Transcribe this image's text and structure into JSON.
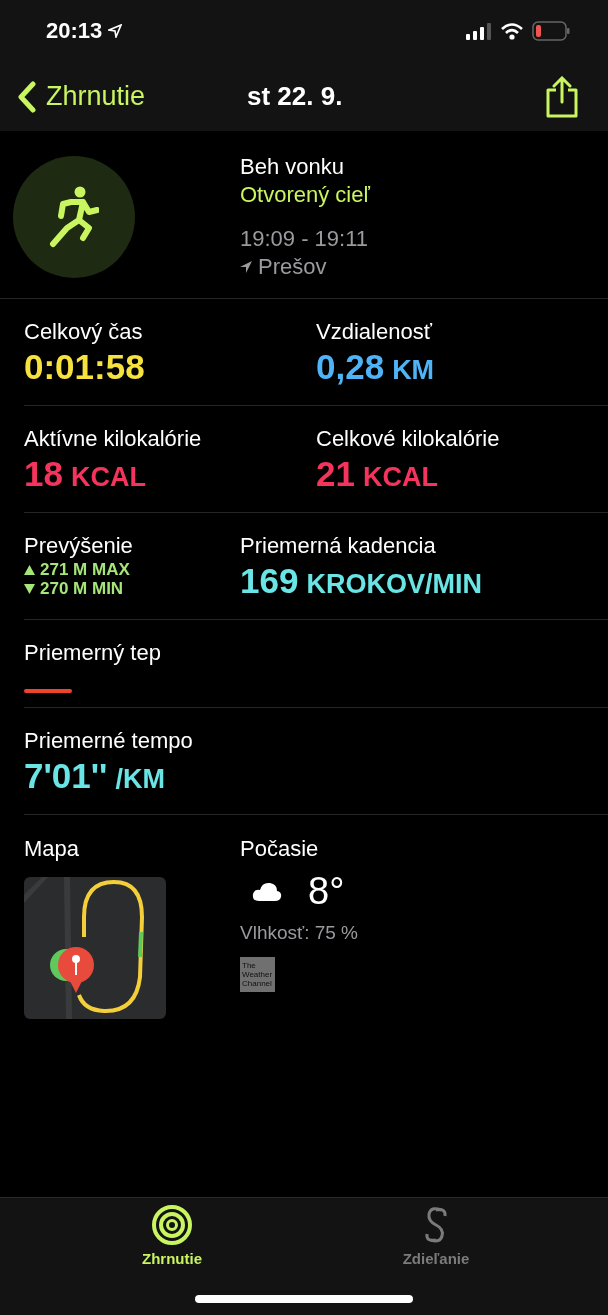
{
  "status_bar": {
    "time": "20:13"
  },
  "nav": {
    "back": "Zhrnutie",
    "title": "st 22. 9."
  },
  "workout": {
    "name": "Beh vonku",
    "goal": "Otvorený cieľ",
    "time_range": "19:09 - 19:11",
    "location": "Prešov"
  },
  "metric_rows": [
    [
      {
        "kind": "value",
        "label": "Celkový čas",
        "value": "0:01:58",
        "color": "#f6e23f"
      },
      {
        "kind": "value",
        "label": "Vzdialenosť",
        "value": "0,28",
        "unit": "KM",
        "color": "#4fb4f7"
      }
    ],
    [
      {
        "kind": "value",
        "label": "Aktívne kilokalórie",
        "value": "18",
        "unit": "KCAL",
        "color": "#f4345d"
      },
      {
        "kind": "value",
        "label": "Celkové kilokalórie",
        "value": "21",
        "unit": "KCAL",
        "color": "#f4345d"
      }
    ],
    [
      {
        "kind": "elevation",
        "label": "Prevýšenie",
        "max": "271 M MAX",
        "min": "270 M MIN",
        "color": "#a5e57a"
      },
      {
        "kind": "value",
        "label": "Priemerná kadencia",
        "value": "169",
        "unit": "KROKOV/MIN",
        "color": "#6ae5e6"
      }
    ],
    [
      {
        "kind": "dash",
        "label": "Priemerný tep",
        "color": "#f0432c"
      }
    ],
    [
      {
        "kind": "value",
        "label": "Priemerné tempo",
        "value": "7'01''",
        "unit": "/KM",
        "color": "#6ae5e6"
      }
    ]
  ],
  "map": {
    "label": "Mapa"
  },
  "weather": {
    "label": "Počasie",
    "temperature": "8°",
    "humidity": "Vlhkosť: 75 %",
    "logo": [
      "The",
      "Weather",
      "Channel"
    ]
  },
  "tabs": [
    {
      "label": "Zhrnutie",
      "selected": true
    },
    {
      "label": "Zdieľanie",
      "selected": false
    }
  ]
}
